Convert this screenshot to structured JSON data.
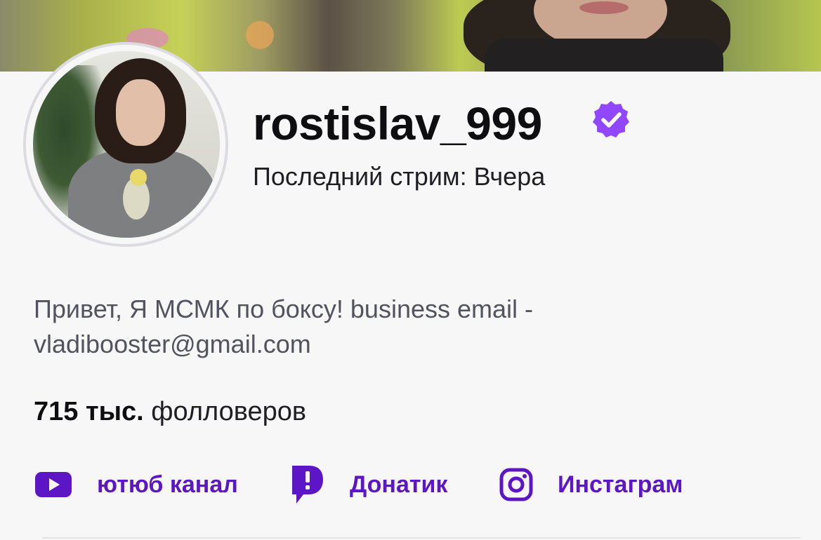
{
  "profile": {
    "username": "rostislav_999",
    "last_stream": "Последний стрим: Вчера",
    "bio": "Привет, Я МСМК по боксу! business email - vladibooster@gmail.com",
    "followers_count": "715 тыс.",
    "followers_label": "фолловеров",
    "verified_icon": "verified-badge-icon",
    "accent_color": "#5c16c5",
    "badge_color": "#9147ff"
  },
  "links": [
    {
      "label": "ютюб канал",
      "icon": "youtube-icon"
    },
    {
      "label": "Донатик",
      "icon": "donation-alerts-icon"
    },
    {
      "label": "Инстаграм",
      "icon": "instagram-icon"
    }
  ]
}
